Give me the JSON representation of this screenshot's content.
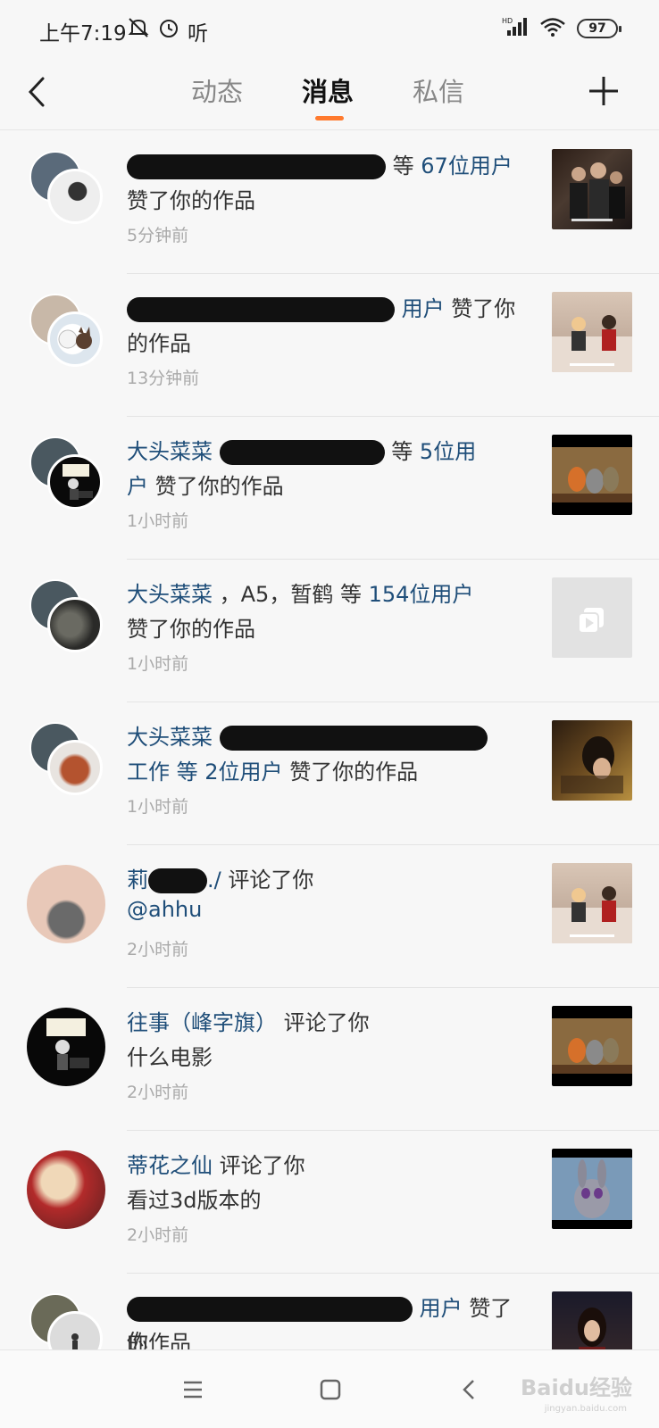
{
  "status_bar": {
    "time": "上午7:19",
    "extra_label": "听",
    "battery": "97",
    "network_label": "HD"
  },
  "header": {
    "tabs": [
      {
        "label": "动态"
      },
      {
        "label": "消息"
      },
      {
        "label": "私信"
      }
    ],
    "active_tab": "消息"
  },
  "notifications": [
    {
      "users_visible": "",
      "suffix_users": "等",
      "count": "67位用户",
      "action": "",
      "second_line": "赞了你的作品",
      "second_line_blue": false,
      "time": "5分钟前",
      "thumb_desc": "movie-scene-crowd"
    },
    {
      "users_visible": "",
      "suffix_users": "",
      "count": "用户",
      "action": "赞了你",
      "second_line": "的作品",
      "second_line_blue": false,
      "time": "13分钟前",
      "thumb_desc": "movie-scene-bed"
    },
    {
      "users_visible": "大头菜菜",
      "suffix_users": "等",
      "count": "5位用",
      "action": "",
      "second_line_prefix": "户",
      "second_line": "赞了你的作品",
      "second_line_blue": false,
      "time": "1小时前",
      "thumb_desc": "zootopia-sloth"
    },
    {
      "users_visible": "大头菜菜",
      "suffix_users": "，A5，暂鹤 等",
      "count": "154位用户",
      "action": "",
      "second_line": "赞了你的作品",
      "second_line_blue": false,
      "time": "1小时前",
      "thumb_desc": "placeholder"
    },
    {
      "users_visible": "大头菜菜",
      "suffix_users": "",
      "count": "",
      "action": "",
      "second_line_prefix": "工作 等 ",
      "second_line_count": "2位用户",
      "second_line": "赞了你的作品",
      "second_line_blue": false,
      "time": "1小时前",
      "thumb_desc": "movie-scene-dark"
    },
    {
      "users_visible": "莉",
      "suffix_users": "./",
      "count": "",
      "action": "评论了你",
      "second_line": "@ahhu",
      "second_line_blue": true,
      "time": "2小时前",
      "thumb_desc": "movie-scene-bed"
    },
    {
      "users_visible": "往事（峰字旗）",
      "suffix_users": "",
      "count": "",
      "action": "评论了你",
      "second_line": "什么电影",
      "second_line_blue": false,
      "time": "2小时前",
      "thumb_desc": "zootopia-sloth"
    },
    {
      "users_visible": "蒂花之仙",
      "suffix_users": "",
      "count": "",
      "action": "评论了你",
      "second_line": "看过3d版本的",
      "second_line_blue": false,
      "time": "2小时前",
      "thumb_desc": "zootopia-judy"
    },
    {
      "users_visible": "",
      "suffix_users": "",
      "count": "用户",
      "action": "赞了你",
      "second_line": "的作品",
      "second_line_blue": false,
      "time": "",
      "thumb_desc": "movie-scene-woman"
    }
  ],
  "watermark": {
    "text": "Baidu经验",
    "sub": "jingyan.baidu.com"
  },
  "colors": {
    "accent": "#ff7a2e",
    "link": "#1f4e79",
    "muted": "#aaaaaa"
  }
}
